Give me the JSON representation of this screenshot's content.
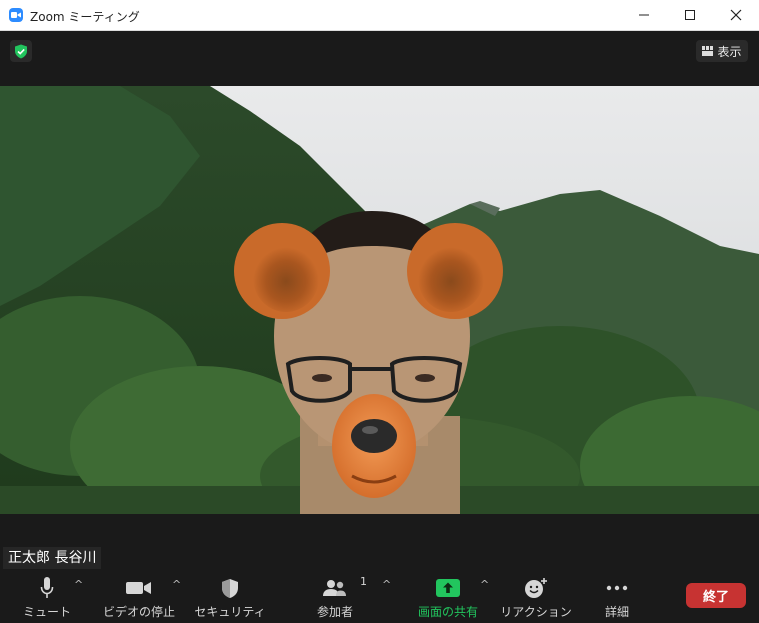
{
  "window": {
    "title": "Zoom ミーティング"
  },
  "top": {
    "view_label": "表示"
  },
  "participant": {
    "name": "正太郎 長谷川"
  },
  "toolbar": {
    "mute_label": "ミュート",
    "video_label": "ビデオの停止",
    "security_label": "セキュリティ",
    "participants_label": "参加者",
    "participants_count": "1",
    "share_label": "画面の共有",
    "reactions_label": "リアクション",
    "more_label": "詳細",
    "end_label": "終了"
  },
  "colors": {
    "share_green": "#22c55e",
    "end_red": "#c73332",
    "shield_green": "#22c55e",
    "zoom_blue": "#2d8cff"
  }
}
